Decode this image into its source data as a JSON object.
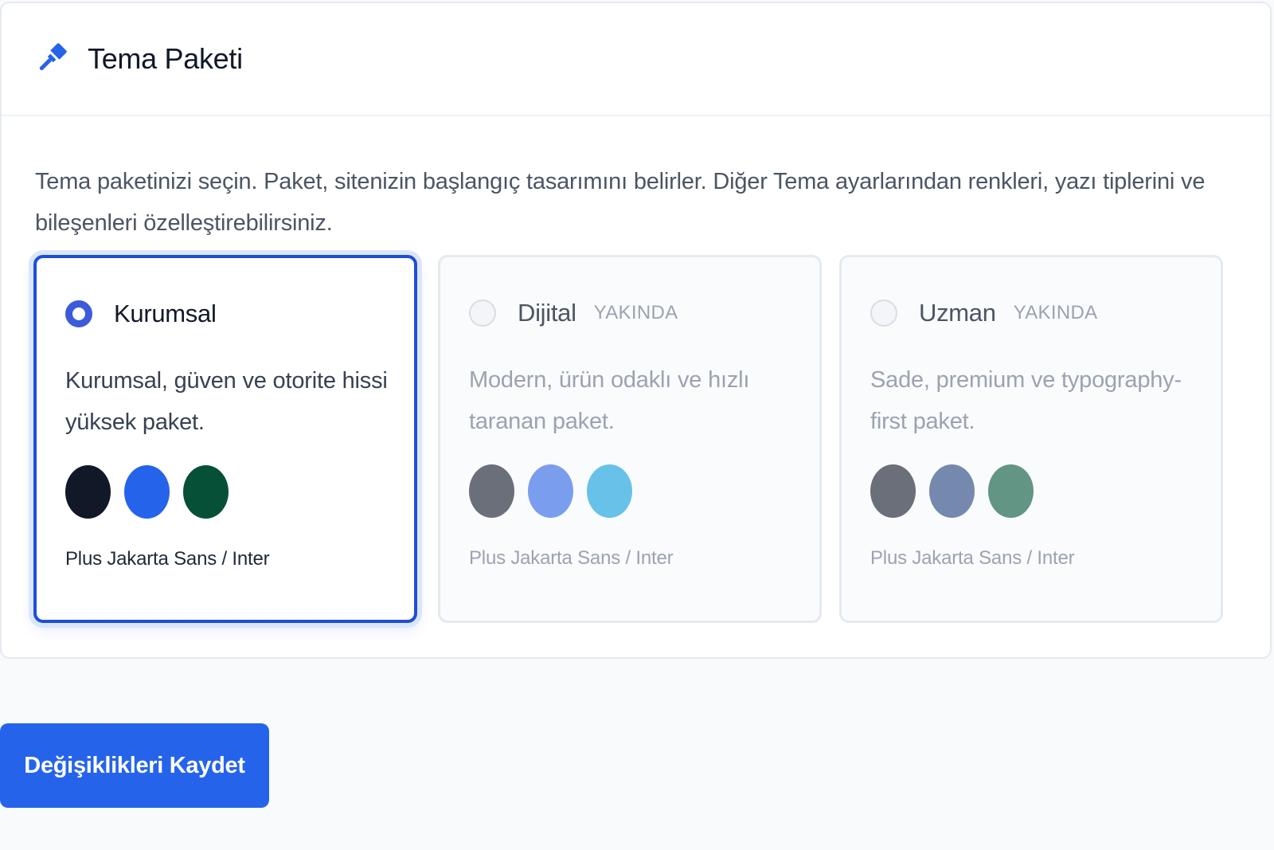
{
  "card": {
    "title": "Tema Paketi",
    "icon": "paintbrush-icon",
    "description": "Tema paketinizi seçin. Paket, sitenizin başlangıç tasarımını belirler. Diğer Tema ayarlarından renkleri, yazı tiplerini ve bileşenleri özelleştirebilirsiniz."
  },
  "packages": [
    {
      "name": "Kurumsal",
      "badge": "",
      "selected": true,
      "disabled": false,
      "description": "Kurumsal, güven ve otorite hissi yüksek paket.",
      "fonts": "Plus Jakarta Sans / Inter",
      "colors": [
        "#111827",
        "#2563eb",
        "#065038"
      ]
    },
    {
      "name": "Dijital",
      "badge": "YAKINDA",
      "selected": false,
      "disabled": true,
      "description": "Modern, ürün odaklı ve hızlı taranan paket.",
      "fonts": "Plus Jakarta Sans / Inter",
      "colors": [
        "#6b6f7a",
        "#7b9ded",
        "#68c1e8"
      ]
    },
    {
      "name": "Uzman",
      "badge": "YAKINDA",
      "selected": false,
      "disabled": true,
      "description": "Sade, premium ve typography-first paket.",
      "fonts": "Plus Jakarta Sans / Inter",
      "colors": [
        "#6b6f7a",
        "#7489ad",
        "#629583"
      ]
    }
  ],
  "actions": {
    "save_label": "Değişiklikleri Kaydet"
  }
}
